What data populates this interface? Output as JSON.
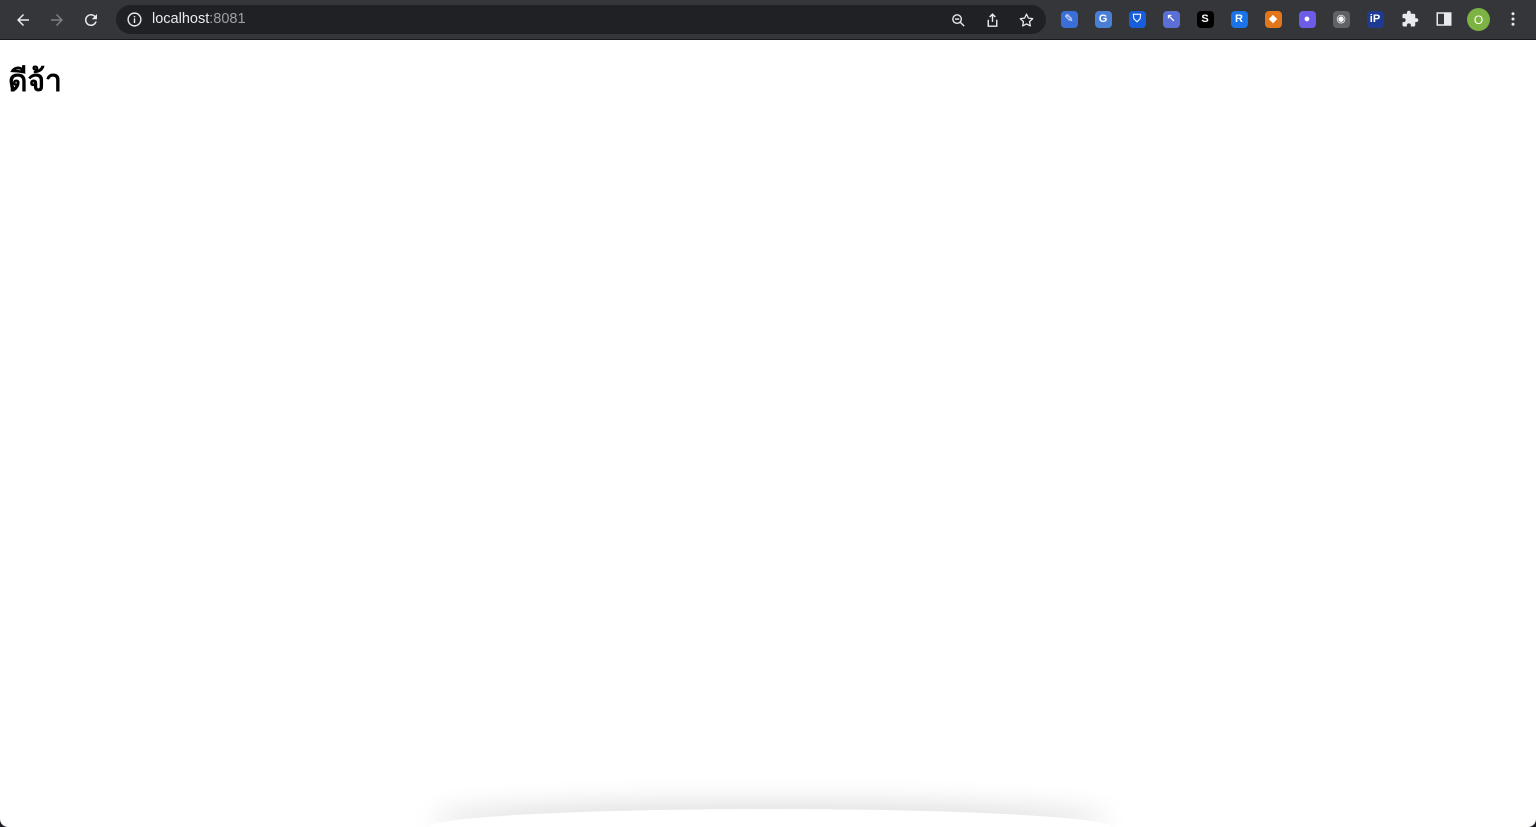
{
  "browser": {
    "url_host": "localhost",
    "url_port": ":8081",
    "profile_initial": "O",
    "extensions": [
      {
        "icon": "pen-arrow-icon",
        "color": "#3b6fd8",
        "glyph": "✎"
      },
      {
        "icon": "google-translate-icon",
        "color": "#4a7fd6",
        "glyph": "G"
      },
      {
        "icon": "bitwarden-shield-icon",
        "color": "#175ddc",
        "glyph": "⛉"
      },
      {
        "icon": "cursor-select-icon",
        "color": "#5b6fd6",
        "glyph": "↖"
      },
      {
        "icon": "s-logo-icon",
        "color": "#000000",
        "glyph": "S"
      },
      {
        "icon": "bookmark-r-icon",
        "color": "#1a73e8",
        "glyph": "R"
      },
      {
        "icon": "metamask-fox-icon",
        "color": "#e2761b",
        "glyph": "◆"
      },
      {
        "icon": "chat-bubble-icon",
        "color": "#6c5ce7",
        "glyph": "●"
      },
      {
        "icon": "camera-icon",
        "color": "#5f6368",
        "glyph": "◉"
      },
      {
        "icon": "ip-icon",
        "color": "#1f3a93",
        "glyph": "iP"
      }
    ]
  },
  "page": {
    "heading": "ดีจ้า"
  }
}
